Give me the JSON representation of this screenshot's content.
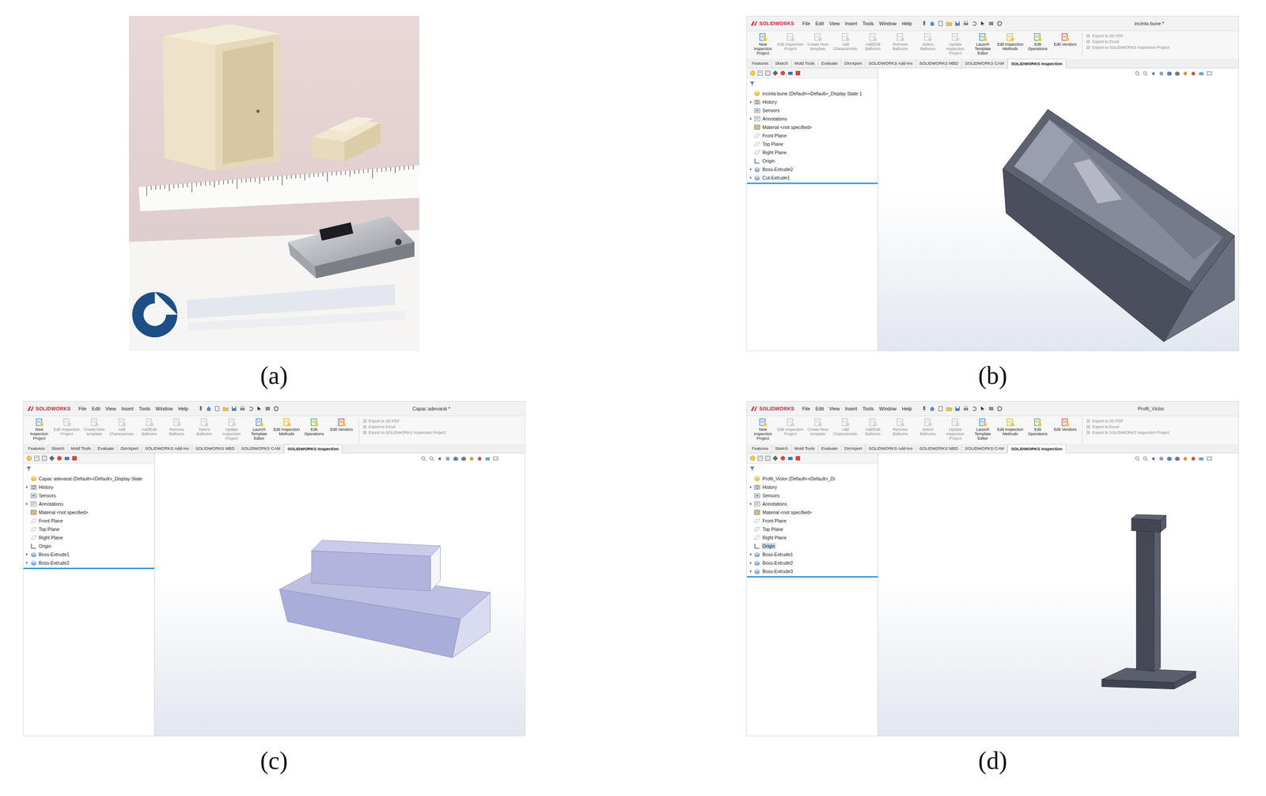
{
  "panels": [
    {
      "label": "(a)",
      "kind": "photo"
    },
    {
      "label": "(b)",
      "kind": "cad",
      "model_kind": "box",
      "app": {
        "logo": "SOLIDWORKS",
        "menu": [
          "File",
          "Edit",
          "View",
          "Insert",
          "Tools",
          "Window",
          "Help"
        ],
        "document_title": "incinta bune *",
        "ribbon": [
          {
            "label": "New Inspection Project",
            "disabled": false
          },
          {
            "label": "Edit Inspection Project",
            "disabled": true
          },
          {
            "label": "Create New template",
            "disabled": true
          },
          {
            "label": "Add Characteristic",
            "disabled": true
          },
          {
            "label": "Add/Edit Balloons",
            "disabled": true
          },
          {
            "label": "Remove Balloons",
            "disabled": true
          },
          {
            "label": "Select Balloons",
            "disabled": true
          },
          {
            "label": "Update Inspection Project",
            "disabled": true
          },
          {
            "label": "Launch Template Editor",
            "disabled": false
          },
          {
            "label": "Edit Inspection Methods",
            "disabled": false
          },
          {
            "label": "Edit Operations",
            "disabled": false
          },
          {
            "label": "Edit Vendors",
            "disabled": false
          }
        ],
        "exports": [
          {
            "label": "Export to 2D PDF",
            "disabled": true
          },
          {
            "label": "Export to Excel",
            "disabled": true
          },
          {
            "label": "Export to SOLIDWORKS Inspection Project",
            "disabled": true
          }
        ],
        "tabs": [
          {
            "label": "Features",
            "selected": false
          },
          {
            "label": "Sketch",
            "selected": false
          },
          {
            "label": "Mold Tools",
            "selected": false
          },
          {
            "label": "Evaluate",
            "selected": false
          },
          {
            "label": "DimXpert",
            "selected": false
          },
          {
            "label": "SOLIDWORKS Add-Ins",
            "selected": false
          },
          {
            "label": "SOLIDWORKS MBD",
            "selected": false
          },
          {
            "label": "SOLIDWORKS CAM",
            "selected": false
          },
          {
            "label": "SOLIDWORKS Inspection",
            "selected": true
          }
        ],
        "tree": [
          {
            "label": "incinta bune  (Default<<Default>_Display State 1",
            "kind": "root",
            "expandable": false,
            "selected": false
          },
          {
            "label": "History",
            "kind": "history",
            "expandable": true,
            "selected": false
          },
          {
            "label": "Sensors",
            "kind": "sensor",
            "expandable": false,
            "selected": false
          },
          {
            "label": "Annotations",
            "kind": "annotation",
            "expandable": true,
            "selected": false
          },
          {
            "label": "Material <not specified>",
            "kind": "material",
            "expandable": false,
            "selected": false
          },
          {
            "label": "Front Plane",
            "kind": "plane",
            "expandable": false,
            "selected": false
          },
          {
            "label": "Top Plane",
            "kind": "plane",
            "expandable": false,
            "selected": false
          },
          {
            "label": "Right Plane",
            "kind": "plane",
            "expandable": false,
            "selected": false
          },
          {
            "label": "Origin",
            "kind": "origin",
            "expandable": false,
            "selected": false
          },
          {
            "label": "Boss-Extrude2",
            "kind": "feature",
            "expandable": true,
            "selected": false
          },
          {
            "label": "Cut-Extrude1",
            "kind": "feature",
            "expandable": true,
            "selected": false
          }
        ]
      }
    },
    {
      "label": "(c)",
      "kind": "cad",
      "model_kind": "lid",
      "app": {
        "logo": "SOLIDWORKS",
        "menu": [
          "File",
          "Edit",
          "View",
          "Insert",
          "Tools",
          "Window",
          "Help"
        ],
        "document_title": "Capac adevarat *",
        "ribbon": [
          {
            "label": "New Inspection Project",
            "disabled": false
          },
          {
            "label": "Edit Inspection Project",
            "disabled": true
          },
          {
            "label": "Create New template",
            "disabled": true
          },
          {
            "label": "Add Characteristic",
            "disabled": true
          },
          {
            "label": "Add/Edit Balloons",
            "disabled": true
          },
          {
            "label": "Remove Balloons",
            "disabled": true
          },
          {
            "label": "Select Balloons",
            "disabled": true
          },
          {
            "label": "Update Inspection Project",
            "disabled": true
          },
          {
            "label": "Launch Template Editor",
            "disabled": false
          },
          {
            "label": "Edit Inspection Methods",
            "disabled": false
          },
          {
            "label": "Edit Operations",
            "disabled": false
          },
          {
            "label": "Edit Vendors",
            "disabled": false
          }
        ],
        "exports": [
          {
            "label": "Export to 2D PDF",
            "disabled": true
          },
          {
            "label": "Export to Excel",
            "disabled": true
          },
          {
            "label": "Export to SOLIDWORKS Inspection Project",
            "disabled": true
          }
        ],
        "tabs": [
          {
            "label": "Features",
            "selected": false
          },
          {
            "label": "Sketch",
            "selected": false
          },
          {
            "label": "Mold Tools",
            "selected": false
          },
          {
            "label": "Evaluate",
            "selected": false
          },
          {
            "label": "DimXpert",
            "selected": false
          },
          {
            "label": "SOLIDWORKS Add-Ins",
            "selected": false
          },
          {
            "label": "SOLIDWORKS MBD",
            "selected": false
          },
          {
            "label": "SOLIDWORKS CAM",
            "selected": false
          },
          {
            "label": "SOLIDWORKS Inspection",
            "selected": true
          }
        ],
        "tree": [
          {
            "label": "Capac adevarat  (Default<<Default>_Display State",
            "kind": "root",
            "expandable": false,
            "selected": false
          },
          {
            "label": "History",
            "kind": "history",
            "expandable": true,
            "selected": false
          },
          {
            "label": "Sensors",
            "kind": "sensor",
            "expandable": false,
            "selected": false
          },
          {
            "label": "Annotations",
            "kind": "annotation",
            "expandable": true,
            "selected": false
          },
          {
            "label": "Material <not specified>",
            "kind": "material",
            "expandable": false,
            "selected": false
          },
          {
            "label": "Front Plane",
            "kind": "plane",
            "expandable": false,
            "selected": false
          },
          {
            "label": "Top Plane",
            "kind": "plane",
            "expandable": false,
            "selected": false
          },
          {
            "label": "Right Plane",
            "kind": "plane",
            "expandable": false,
            "selected": false
          },
          {
            "label": "Origin",
            "kind": "origin",
            "expandable": false,
            "selected": false
          },
          {
            "label": "Boss-Extrude1",
            "kind": "feature",
            "expandable": true,
            "selected": false
          },
          {
            "label": "Boss-Extrude2",
            "kind": "feature",
            "expandable": true,
            "selected": false
          }
        ]
      }
    },
    {
      "label": "(d)",
      "kind": "cad",
      "model_kind": "profile",
      "app": {
        "logo": "SOLIDWORKS",
        "menu": [
          "File",
          "Edit",
          "View",
          "Insert",
          "Tools",
          "Window",
          "Help"
        ],
        "document_title": "Profil_Victor",
        "ribbon": [
          {
            "label": "New Inspection Project",
            "disabled": false
          },
          {
            "label": "Edit Inspection Project",
            "disabled": true
          },
          {
            "label": "Create New template",
            "disabled": true
          },
          {
            "label": "Add Characteristic",
            "disabled": true
          },
          {
            "label": "Add/Edit Balloons",
            "disabled": true
          },
          {
            "label": "Remove Balloons",
            "disabled": true
          },
          {
            "label": "Select Balloons",
            "disabled": true
          },
          {
            "label": "Update Inspection Project",
            "disabled": true
          },
          {
            "label": "Launch Template Editor",
            "disabled": false
          },
          {
            "label": "Edit Inspection Methods",
            "disabled": false
          },
          {
            "label": "Edit Operations",
            "disabled": false
          },
          {
            "label": "Edit Vendors",
            "disabled": false
          }
        ],
        "exports": [
          {
            "label": "Export to 2D PDF",
            "disabled": true
          },
          {
            "label": "Export to Excel",
            "disabled": true
          },
          {
            "label": "Export to SOLIDWORKS Inspection Project",
            "disabled": true
          }
        ],
        "tabs": [
          {
            "label": "Features",
            "selected": false
          },
          {
            "label": "Sketch",
            "selected": false
          },
          {
            "label": "Mold Tools",
            "selected": false
          },
          {
            "label": "Evaluate",
            "selected": false
          },
          {
            "label": "DimXpert",
            "selected": false
          },
          {
            "label": "SOLIDWORKS Add-Ins",
            "selected": false
          },
          {
            "label": "SOLIDWORKS MBD",
            "selected": false
          },
          {
            "label": "SOLIDWORKS CAM",
            "selected": false
          },
          {
            "label": "SOLIDWORKS Inspection",
            "selected": true
          }
        ],
        "tree": [
          {
            "label": "Profil_Victor  (Default<<Default>_Di",
            "kind": "root",
            "expandable": false,
            "selected": false
          },
          {
            "label": "History",
            "kind": "history",
            "expandable": true,
            "selected": false
          },
          {
            "label": "Sensors",
            "kind": "sensor",
            "expandable": false,
            "selected": false
          },
          {
            "label": "Annotations",
            "kind": "annotation",
            "expandable": true,
            "selected": false
          },
          {
            "label": "Material <not specified>",
            "kind": "material",
            "expandable": false,
            "selected": false
          },
          {
            "label": "Front Plane",
            "kind": "plane",
            "expandable": false,
            "selected": false
          },
          {
            "label": "Top Plane",
            "kind": "plane",
            "expandable": false,
            "selected": false
          },
          {
            "label": "Right Plane",
            "kind": "plane",
            "expandable": false,
            "selected": false
          },
          {
            "label": "Origin",
            "kind": "origin",
            "expandable": false,
            "selected": true
          },
          {
            "label": "Boss-Extrude1",
            "kind": "feature",
            "expandable": true,
            "selected": false
          },
          {
            "label": "Boss-Extrude2",
            "kind": "feature",
            "expandable": true,
            "selected": false
          },
          {
            "label": "Boss-Extrude3",
            "kind": "feature",
            "expandable": true,
            "selected": false
          }
        ]
      }
    }
  ]
}
